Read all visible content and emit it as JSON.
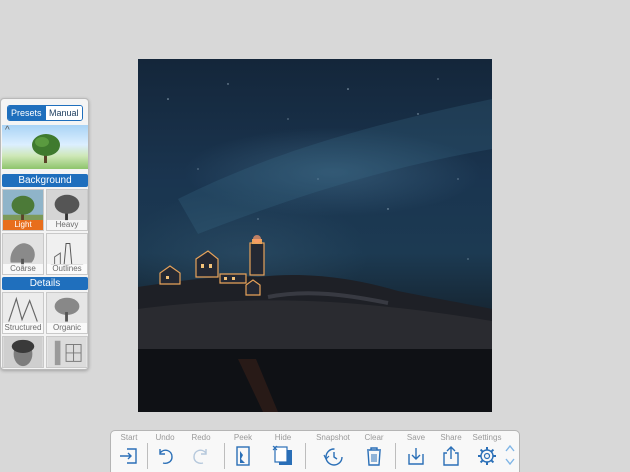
{
  "panel": {
    "tabs": {
      "presets": "Presets",
      "manual": "Manual"
    },
    "background_header": "Background",
    "details_header": "Details",
    "background_items": [
      "Light",
      "Heavy",
      "Coarse",
      "Outlines"
    ],
    "details_items": [
      "Structured",
      "Organic",
      "",
      ""
    ],
    "selected_item": "Light",
    "accent": "#1f6fbd",
    "selected_color": "#e86e1c"
  },
  "toolbar": {
    "start": "Start",
    "undo": "Undo",
    "redo": "Redo",
    "peek": "Peek",
    "hide": "Hide",
    "snapshot": "Snapshot",
    "clear": "Clear",
    "save": "Save",
    "share": "Share",
    "settings": "Settings"
  }
}
